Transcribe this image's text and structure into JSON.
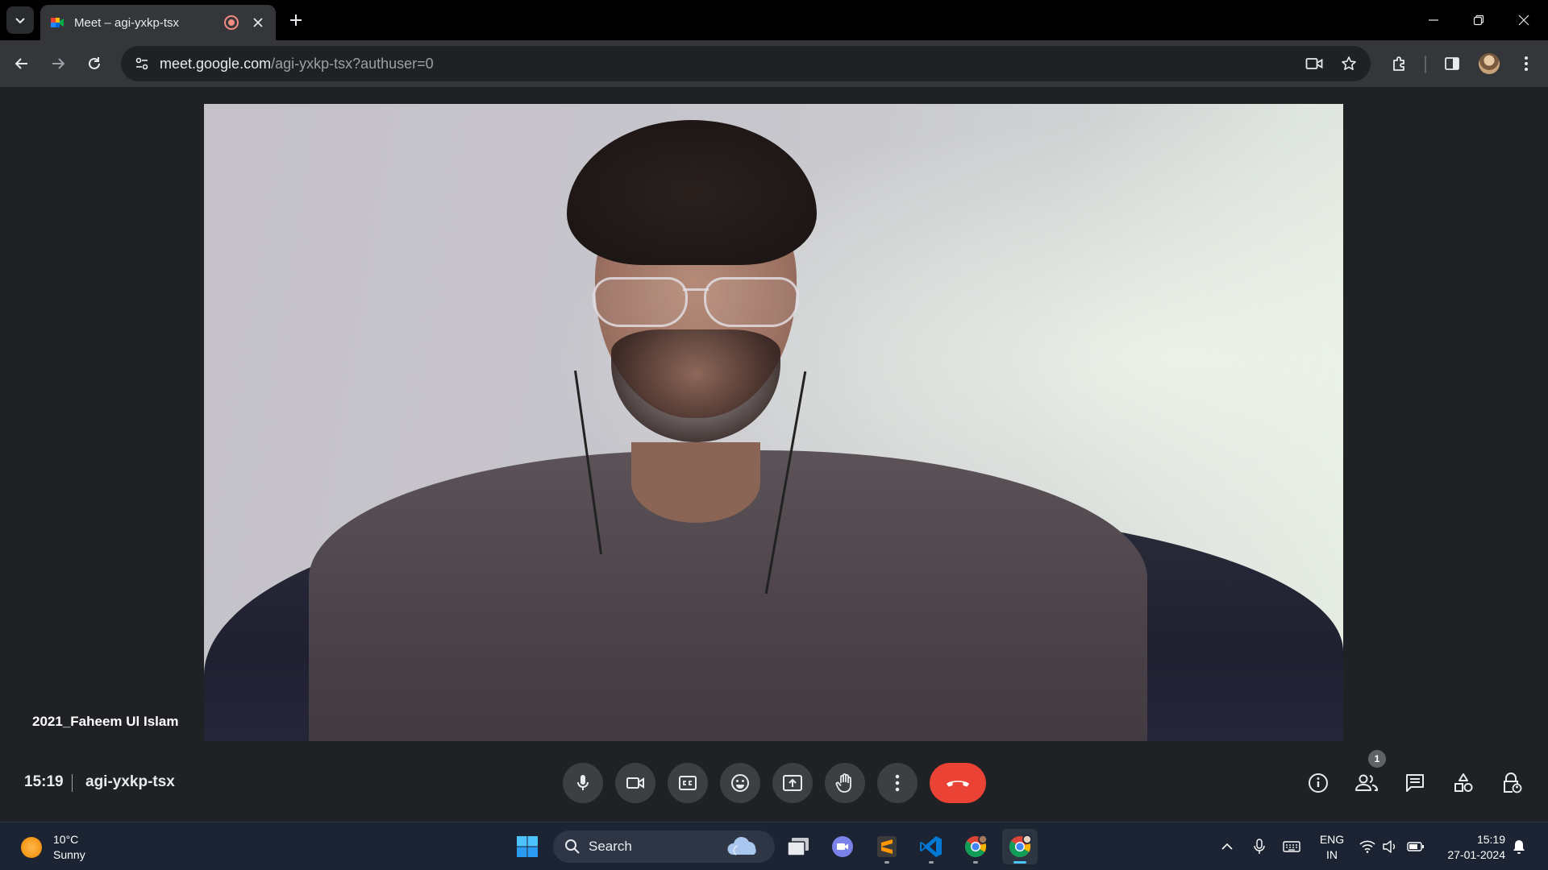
{
  "browser": {
    "tab": {
      "title": "Meet – agi-yxkp-tsx"
    },
    "omnibox": {
      "host": "meet.google.com",
      "path": "/agi-yxkp-tsx?authuser=0"
    }
  },
  "meet": {
    "participant_name": "2021_Faheem Ul Islam",
    "time": "15:19",
    "meeting_code": "agi-yxkp-tsx",
    "people_count": "1",
    "colors": {
      "background": "#202124",
      "control_bg": "#3c4043",
      "end_call": "#ea4335"
    }
  },
  "taskbar": {
    "weather": {
      "temp": "10°C",
      "condition": "Sunny"
    },
    "search_label": "Search",
    "language": {
      "line1": "ENG",
      "line2": "IN"
    },
    "clock": {
      "time": "15:19",
      "date": "27-01-2024"
    }
  }
}
